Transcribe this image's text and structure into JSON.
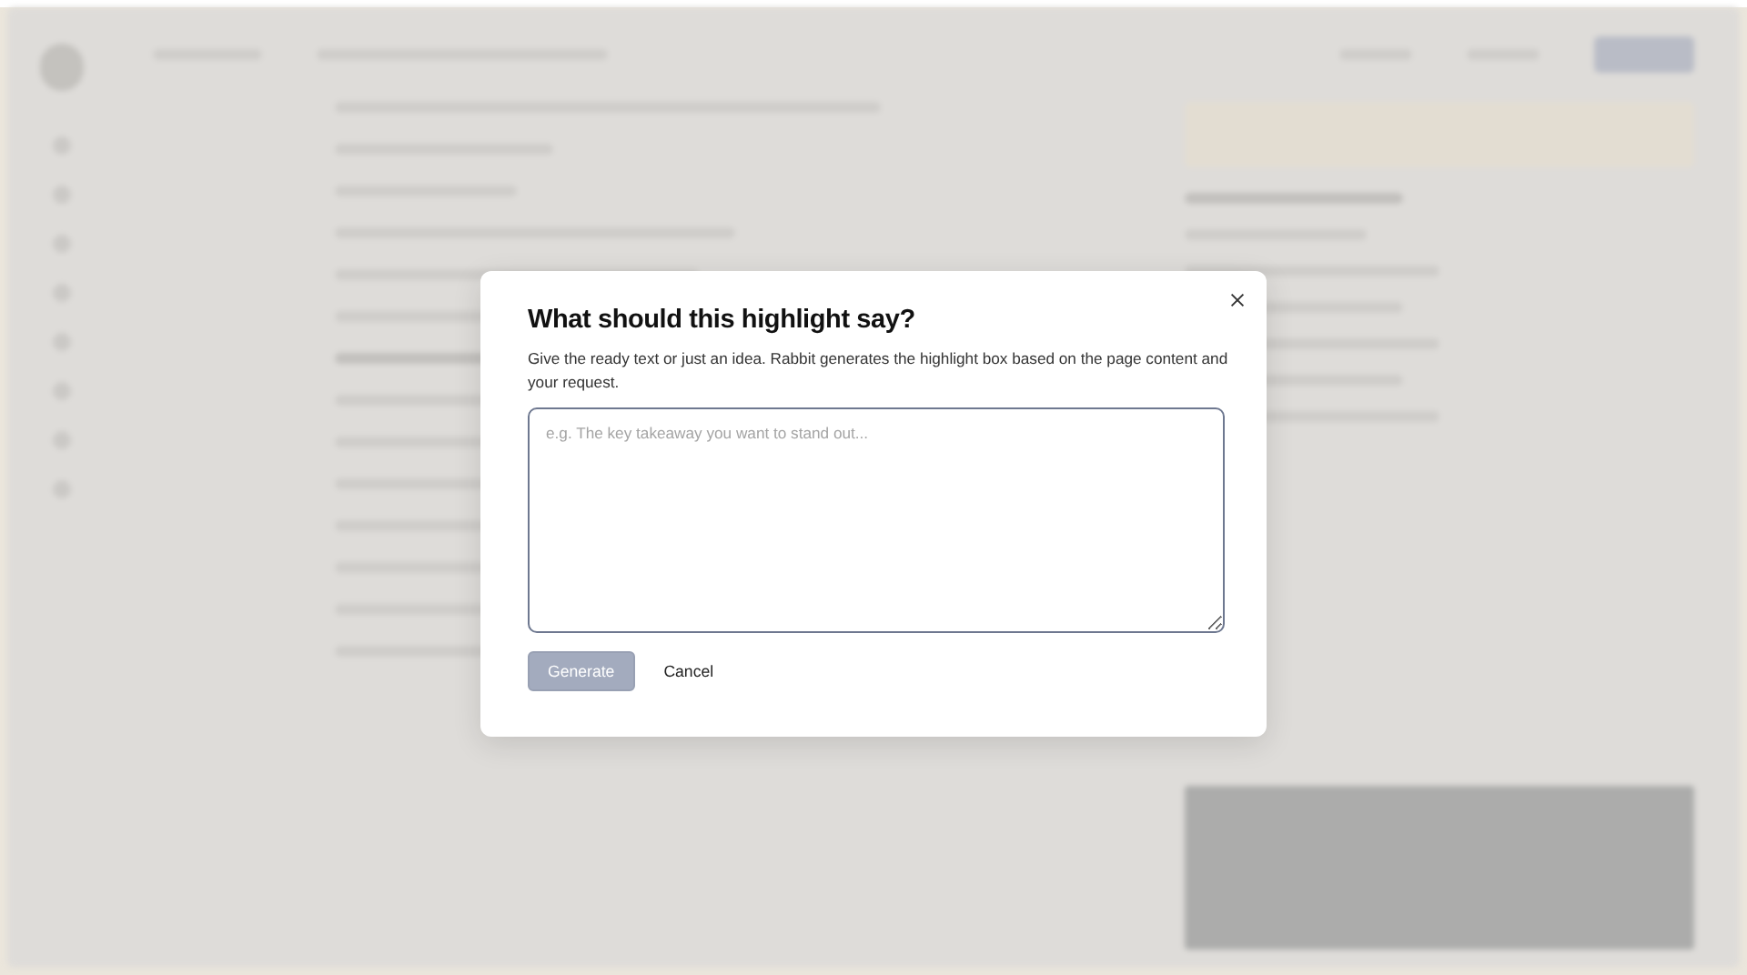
{
  "dialog": {
    "title": "What should this highlight say?",
    "description": "Give the ready text or just an idea. Rabbit generates the highlight box based on the page content and your request.",
    "input": {
      "placeholder": "e.g. The key takeaway you want to stand out..."
    },
    "buttons": [
      {
        "kind": "primary",
        "label": "Generate",
        "disabled": true
      },
      {
        "kind": "plain",
        "label": "Cancel",
        "disabled": false
      }
    ]
  }
}
